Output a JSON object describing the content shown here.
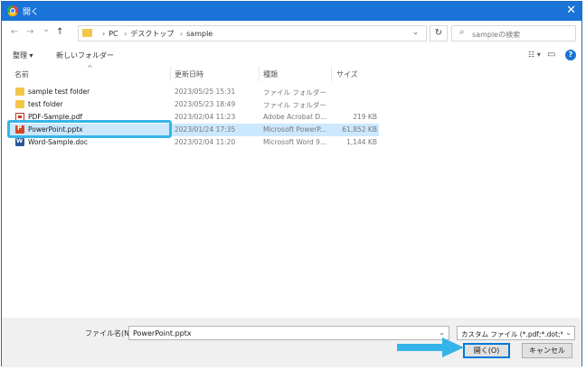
{
  "window": {
    "title": "開く",
    "close_icon": "close-icon"
  },
  "nav": {
    "back_icon": "←",
    "forward_icon": "→",
    "recent_icon": "⌄",
    "up_icon": "↑",
    "breadcrumbs": [
      "PC",
      "デスクトップ",
      "sample"
    ],
    "dropdown_icon": "⌄",
    "refresh_icon": "↻",
    "search_placeholder": "sampleの検索"
  },
  "toolbar": {
    "organize_label": "整理 ▾",
    "new_folder_label": "新しいフォルダー",
    "view_icon": "☷ ▾",
    "pane_icon": "▭",
    "help_icon": "?"
  },
  "columns": {
    "name": "名前",
    "date": "更新日時",
    "type": "種類",
    "size": "サイズ"
  },
  "files": [
    {
      "name": "sample test folder",
      "date": "2023/05/25 15:31",
      "type": "ファイル フォルダー",
      "size": "",
      "icon": "folder"
    },
    {
      "name": "test folder",
      "date": "2023/05/23 18:49",
      "type": "ファイル フォルダー",
      "size": "",
      "icon": "folder"
    },
    {
      "name": "PDF-Sample.pdf",
      "date": "2023/02/04 11:23",
      "type": "Adobe Acrobat D...",
      "size": "219 KB",
      "icon": "pdf"
    },
    {
      "name": "PowerPoint.pptx",
      "date": "2023/01/24 17:35",
      "type": "Microsoft PowerP...",
      "size": "61,852 KB",
      "icon": "ppt",
      "selected": true
    },
    {
      "name": "Word-Sample.doc",
      "date": "2023/02/04 11:20",
      "type": "Microsoft Word 9...",
      "size": "1,144 KB",
      "icon": "word"
    }
  ],
  "footer": {
    "filename_label": "ファイル名(N):",
    "filename_value": "PowerPoint.pptx",
    "filter_value": "カスタム ファイル (*.pdf;*.dot;*.doc",
    "open_label": "開く(O)",
    "cancel_label": "キャンセル"
  },
  "colors": {
    "accent": "#1a73d6",
    "highlight": "#35b4e9",
    "selection": "#cce8ff"
  }
}
